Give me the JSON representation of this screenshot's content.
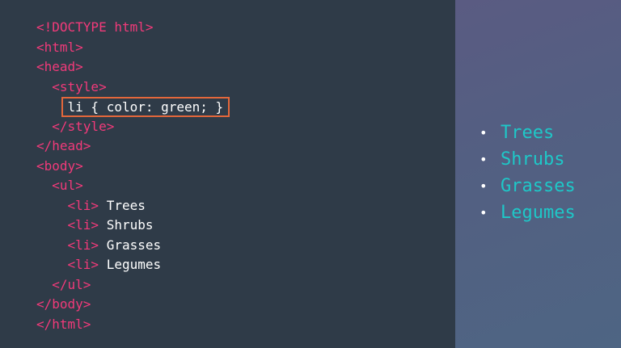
{
  "code": {
    "doctype": "<!DOCTYPE html>",
    "html_open": "<html>",
    "head_open": "<head>",
    "style_open": "<style>",
    "css_rule": "li { color: green; }",
    "style_close": "</style>",
    "head_close": "</head>",
    "body_open": "<body>",
    "ul_open": "<ul>",
    "li_tag": "<li>",
    "items": [
      "Trees",
      "Shrubs",
      "Grasses",
      "Legumes"
    ],
    "ul_close": "</ul>",
    "body_close": "</body>",
    "html_close": "</html>"
  },
  "preview": {
    "bullet": "•",
    "items": [
      "Trees",
      "Shrubs",
      "Grasses",
      "Legumes"
    ]
  },
  "colors": {
    "tag": "#f23a7a",
    "text": "#ffffff",
    "highlight_border": "#e4673b",
    "list_item": "#1ec8c8",
    "code_bg": "#2f3b48"
  }
}
